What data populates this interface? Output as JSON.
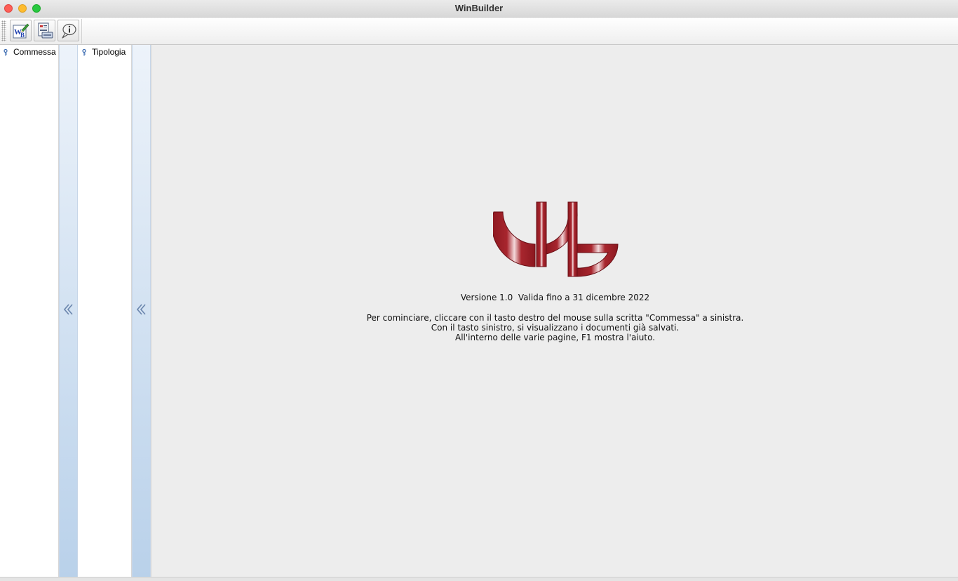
{
  "window": {
    "title": "WinBuilder"
  },
  "toolbar": {
    "buttons": [
      {
        "icon": "winbuilder-edit-icon"
      },
      {
        "icon": "print-document-icon"
      },
      {
        "icon": "info-balloon-icon"
      }
    ]
  },
  "trees": {
    "left": {
      "node_label": "Commessa",
      "icon": "key-icon"
    },
    "right": {
      "node_label": "Tipologia",
      "icon": "key-icon"
    }
  },
  "collapse": {
    "icon": "double-chevron-left-icon"
  },
  "main": {
    "logo": "wb-logo",
    "version_text": "Versione 1.0  Valida fino a 31 dicembre 2022",
    "instructions": [
      "Per cominciare, cliccare con il tasto destro del mouse sulla scritta \"Commessa\" a sinistra.",
      "Con il tasto sinistro, si visualizzano i documenti già salvati.",
      "All'interno delle varie pagine, F1 mostra l'aiuto."
    ]
  },
  "colors": {
    "logo_red": "#9b1c24",
    "collapse_bar_top": "#edf3fa",
    "collapse_bar_bottom": "#b9d1ea",
    "main_bg": "#ededed"
  }
}
